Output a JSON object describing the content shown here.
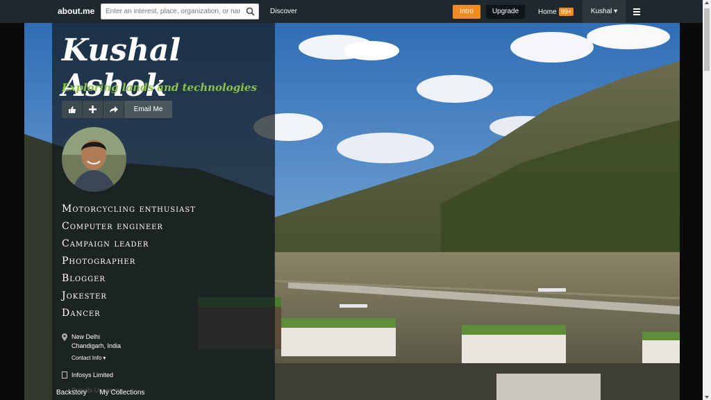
{
  "topbar": {
    "logo": "about.me",
    "search_placeholder": "Enter an interest, place, organization, or name",
    "discover": "Discover",
    "intro": "Intro",
    "upgrade": "Upgrade",
    "home": "Home",
    "home_badge": "99+",
    "user": "Kushal ▾"
  },
  "profile": {
    "name": "Kushal Ashok",
    "tagline": "Exploring lands and technologies",
    "email_button": "Email Me",
    "roles": [
      "Motorcycling enthusiast",
      "Computer engineer",
      "Campaign leader",
      "Photographer",
      "Blogger",
      "Jokester",
      "Dancer"
    ],
    "location_line1": "New Delhi",
    "location_line2": "Chandigarh, India",
    "contact_info": "Contact Info ▾",
    "work": "Infosys Limited",
    "education_faded": "Punjabi University"
  },
  "tabs": {
    "backstory": "Backstory",
    "collections": "My Collections"
  },
  "colors": {
    "accent": "#f08a22",
    "tagline": "#8bc34a"
  }
}
